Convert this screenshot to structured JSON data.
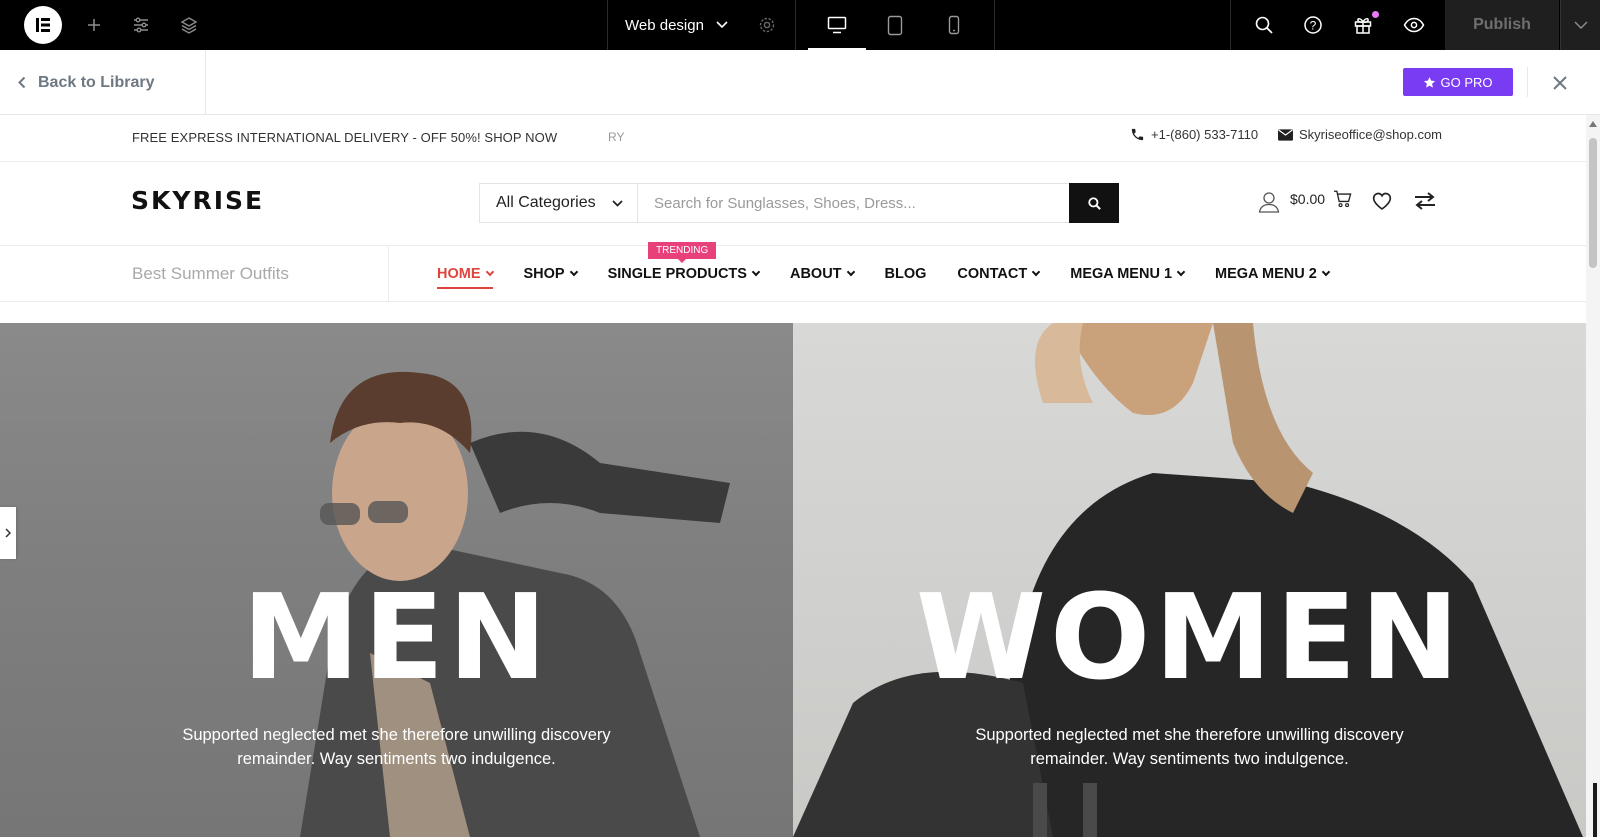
{
  "topbar": {
    "document_title": "Web design",
    "publish_label": "Publish"
  },
  "library": {
    "back_label": "Back to Library",
    "go_pro_label": "GO PRO"
  },
  "site": {
    "announcement": "FREE EXPRESS INTERNATIONAL DELIVERY - OFF 50%! SHOP NOW",
    "announcement_ghost": "RY",
    "phone": "+1-(860) 533-7110",
    "email": "Skyriseoffice@shop.com",
    "brand": "SKYRISE",
    "category_select": "All Categories",
    "search_placeholder": "Search for Sunglasses, Shoes, Dress...",
    "cart_total": "$0.00",
    "nav_promo": "Best Summer Outfits",
    "trending_badge": "TRENDING",
    "nav": [
      {
        "label": "HOME"
      },
      {
        "label": "SHOP"
      },
      {
        "label": "SINGLE PRODUCTS"
      },
      {
        "label": "ABOUT"
      },
      {
        "label": "BLOG"
      },
      {
        "label": "CONTACT"
      },
      {
        "label": "MEGA MENU 1"
      },
      {
        "label": "MEGA MENU 2"
      }
    ],
    "hero": {
      "men_title": "MEN",
      "men_text": "Supported neglected met she therefore unwilling discovery remainder. Way sentiments two indulgence.",
      "women_title": "WOMEN",
      "women_text": "Supported neglected met she therefore unwilling discovery remainder. Way sentiments two indulgence."
    }
  },
  "colors": {
    "accent_purple": "#7a3cf2",
    "nav_active": "#e0443e",
    "badge_pink": "#e8407a"
  }
}
